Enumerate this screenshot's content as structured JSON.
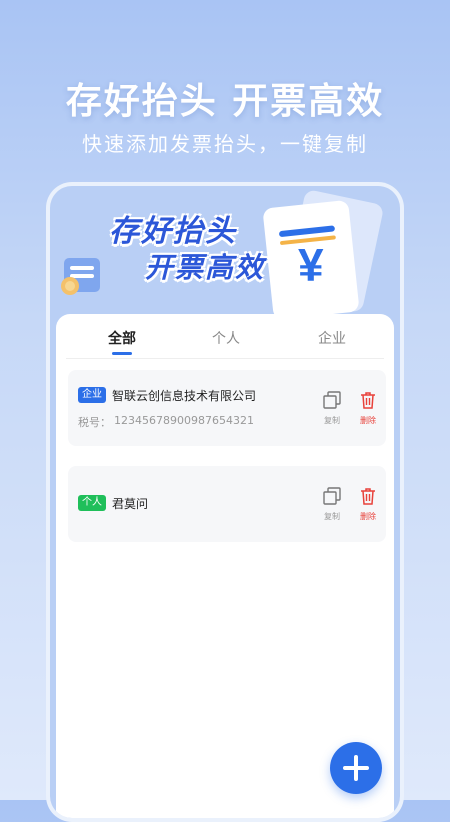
{
  "headline": "存好抬头 开票高效",
  "subline": "快速添加发票抬头，一键复制",
  "banner": {
    "line1": "存好抬头",
    "line2": "开票高效",
    "currency_symbol": "¥"
  },
  "tabs": [
    {
      "label": "全部",
      "active": true
    },
    {
      "label": "个人",
      "active": false
    },
    {
      "label": "企业",
      "active": false
    }
  ],
  "cards": [
    {
      "badge": "企业",
      "badge_color": "#2c6fe8",
      "name": "智联云创信息技术有限公司",
      "tax_label": "税号：",
      "tax_no": "12345678900987654321",
      "copy_label": "复制",
      "delete_label": "删除"
    },
    {
      "badge": "个人",
      "badge_color": "#1fbf5a",
      "name": "君莫问",
      "copy_label": "复制",
      "delete_label": "删除"
    }
  ],
  "colors": {
    "accent": "#2c6fe8",
    "delete": "#e8413a"
  }
}
